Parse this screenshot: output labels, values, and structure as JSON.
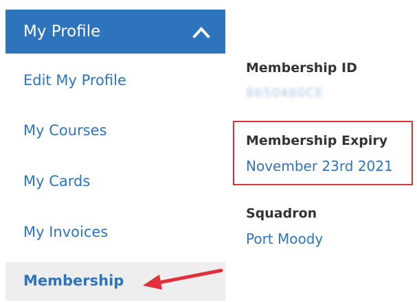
{
  "sidebar": {
    "header_label": "My Profile",
    "header_icon": "chevron-up-icon",
    "items": [
      {
        "label": "Edit My Profile",
        "active": false
      },
      {
        "label": "My Courses",
        "active": false
      },
      {
        "label": "My Cards",
        "active": false
      },
      {
        "label": "My Invoices",
        "active": false
      },
      {
        "label": "Membership",
        "active": true
      }
    ]
  },
  "details": {
    "membership_id": {
      "label": "Membership ID",
      "value": "8650480CE"
    },
    "membership_expiry": {
      "label": "Membership Expiry",
      "value": "November 23rd 2021"
    },
    "squadron": {
      "label": "Squadron",
      "value": "Port Moody"
    }
  },
  "colors": {
    "brand_blue": "#2e74bd",
    "active_bg": "#eeeeee",
    "annotation_red": "#e0303a"
  }
}
